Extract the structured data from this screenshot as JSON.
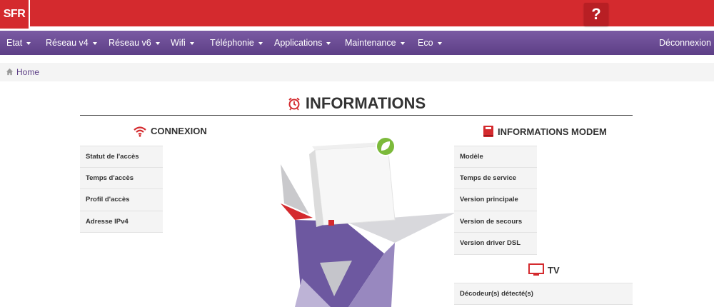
{
  "brand": {
    "logo_text": "SFR",
    "help_label": "?"
  },
  "nav": {
    "items": [
      {
        "label": "Etat",
        "dropdown": true
      },
      {
        "label": "Réseau v4",
        "dropdown": true
      },
      {
        "label": "Réseau v6",
        "dropdown": true
      },
      {
        "label": "Wifi",
        "dropdown": true
      },
      {
        "label": "Téléphonie",
        "dropdown": true
      },
      {
        "label": "Applications",
        "dropdown": true
      },
      {
        "label": "Maintenance",
        "dropdown": true
      },
      {
        "label": "Eco",
        "dropdown": true
      }
    ],
    "logout_label": "Déconnexion"
  },
  "breadcrumb": {
    "home_label": "Home"
  },
  "informations": {
    "title": "INFORMATIONS"
  },
  "connexion": {
    "title": "CONNEXION",
    "rows": [
      "Statut de l'accès",
      "Temps d'accès",
      "Profil d'accès",
      "Adresse IPv4"
    ]
  },
  "modem": {
    "title": "INFORMATIONS MODEM",
    "rows": [
      "Modèle",
      "Temps de service",
      "Version principale",
      "Version de secours",
      "Version driver DSL"
    ]
  },
  "tv": {
    "title": "TV",
    "rows": [
      "Décodeur(s) détecté(s)"
    ]
  },
  "colors": {
    "brand_red": "#d42a2e",
    "nav_purple": "#6a4b94",
    "eco_green": "#7cba3b"
  }
}
